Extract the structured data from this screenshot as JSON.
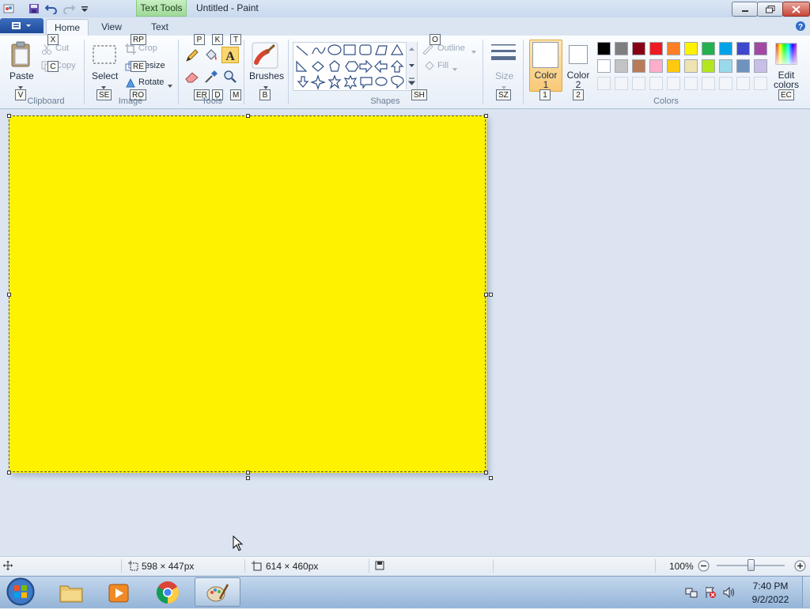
{
  "window": {
    "title": "Untitled - Paint",
    "context_tab": "Text Tools"
  },
  "tabs": [
    {
      "label": "Home",
      "active": true
    },
    {
      "label": "View",
      "active": false
    },
    {
      "label": "Text",
      "active": false
    }
  ],
  "clipboard": {
    "paste_label": "Paste",
    "cut_label": "Cut",
    "copy_label": "Copy",
    "group_label": "Clipboard",
    "keys": {
      "paste": "V",
      "cut": "X",
      "copy": "C"
    }
  },
  "image": {
    "select_label": "Select",
    "crop_label": "Crop",
    "resize_label": "Resize",
    "rotate_label": "Rotate",
    "group_label": "Image",
    "keys": {
      "select": "SE",
      "crop": "RP",
      "resize": "RE",
      "rotate": "RO"
    }
  },
  "tools": {
    "group_label": "Tools",
    "keys": {
      "pencil": "P",
      "fill": "K",
      "text": "T",
      "eraser": "ER",
      "picker": "D",
      "magnifier": "M"
    }
  },
  "brushes": {
    "label": "Brushes",
    "key": "B"
  },
  "shapes": {
    "group_label": "Shapes",
    "outline_label": "Outline",
    "fill_label": "Fill",
    "key": "SH",
    "outline_key": "O"
  },
  "size": {
    "label": "Size",
    "key": "SZ"
  },
  "colors": {
    "color1_label": "Color 1",
    "color2_label": "Color 2",
    "color1_key": "1",
    "color2_key": "2",
    "edit_label": "Edit colors",
    "edit_key": "EC",
    "group_label": "Colors",
    "color1_value": "#ffffff",
    "color2_value": "#ffffff",
    "palette_row1": [
      "#000000",
      "#7f7f7f",
      "#880015",
      "#ed1c24",
      "#ff7f27",
      "#fff200",
      "#22b14c",
      "#00a2e8",
      "#3f48cc",
      "#a349a4"
    ],
    "palette_row2": [
      "#ffffff",
      "#c3c3c3",
      "#b97a57",
      "#ffaec9",
      "#ffc90e",
      "#efe4b0",
      "#b5e61d",
      "#99d9ea",
      "#7092be",
      "#c8bfe7"
    ]
  },
  "canvas": {
    "fill_color": "#fff200"
  },
  "status": {
    "selection_size": "598 × 447px",
    "image_size": "614 × 460px",
    "zoom": "100%"
  },
  "taskbar": {
    "time": "7:40 PM",
    "date": "9/2/2022"
  }
}
